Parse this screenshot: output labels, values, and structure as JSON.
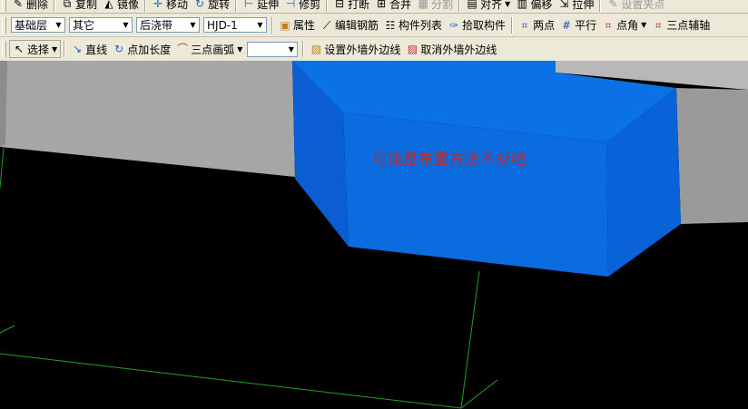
{
  "toolbar_top": {
    "items": [
      {
        "label": "删除",
        "icon": "delete-icon"
      },
      {
        "label": "复制",
        "icon": "copy-icon"
      },
      {
        "label": "镜像",
        "icon": "mirror-icon"
      },
      {
        "label": "移动",
        "icon": "move-icon"
      },
      {
        "label": "旋转",
        "icon": "rotate-icon"
      },
      {
        "label": "延伸",
        "icon": "extend-icon"
      },
      {
        "label": "修剪",
        "icon": "trim-icon"
      },
      {
        "label": "打断",
        "icon": "break-icon"
      },
      {
        "label": "合并",
        "icon": "merge-icon"
      },
      {
        "label": "分割",
        "icon": "split-icon"
      },
      {
        "label": "对齐",
        "icon": "align-icon"
      },
      {
        "label": "偏移",
        "icon": "offset-icon"
      },
      {
        "label": "拉伸",
        "icon": "stretch-icon"
      },
      {
        "label": "设置夹点",
        "icon": "grip-point-icon"
      }
    ]
  },
  "toolbar_mid": {
    "floor_select": "基础层",
    "category_select": "其它",
    "component_type_select": "后浇带",
    "component_select": "HJD-1",
    "properties": "属性",
    "edit_rebar": "编辑钢筋",
    "component_list": "构件列表",
    "pick_component": "拾取构件",
    "two_points": "两点",
    "parallel": "平行",
    "point_angle": "点角",
    "three_point_axis": "三点辅轴"
  },
  "toolbar_draw": {
    "select": "选择",
    "line": "直线",
    "point_length": "点加长度",
    "three_point_arc": "三点画弧",
    "arc_value": "",
    "set_outer_wall_edge": "设置外墙外边线",
    "cancel_outer_wall_edge": "取消外墙外边线"
  },
  "viewport": {
    "overlay_message": "可能是布置方法不对吧"
  },
  "colors": {
    "toolbar_bg": "#ece9d8",
    "viewport_bg": "#000000",
    "blue_block": "#0a6fe3",
    "gray_block": "#a4a4a4",
    "overlay_text": "#c02828",
    "axis_line": "#22a022"
  }
}
